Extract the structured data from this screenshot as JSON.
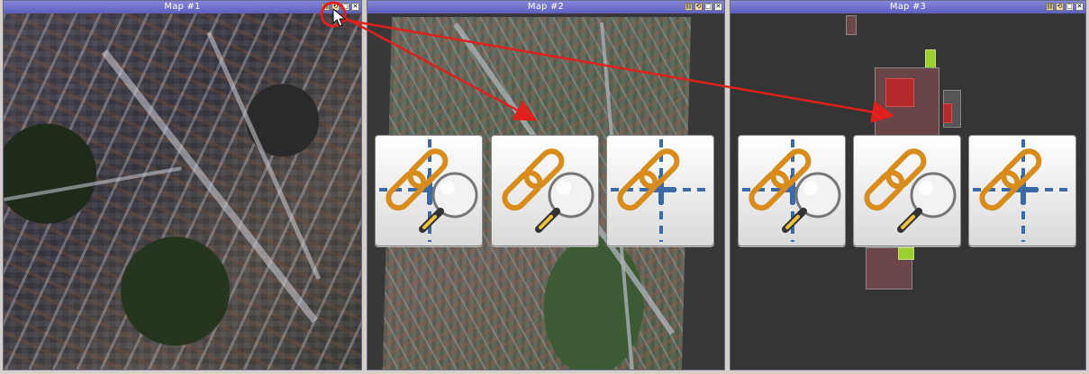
{
  "windows": [
    {
      "title": "Map #1"
    },
    {
      "title": "Map #2"
    },
    {
      "title": "Map #3"
    }
  ],
  "titlebar_buttons": [
    "link-icon",
    "sync-icon",
    "maximize-icon",
    "close-icon"
  ],
  "close_glyph": "✕",
  "tools": [
    {
      "name": "link-pan-zoom-tool",
      "icon": "link-pan-zoom-icon"
    },
    {
      "name": "link-zoom-tool",
      "icon": "link-zoom-icon"
    },
    {
      "name": "link-pan-tool",
      "icon": "link-pan-icon"
    },
    {
      "name": "link-pan-zoom-tool",
      "icon": "link-pan-zoom-icon"
    },
    {
      "name": "link-zoom-tool",
      "icon": "link-zoom-icon"
    },
    {
      "name": "link-pan-tool",
      "icon": "link-pan-icon"
    }
  ],
  "colors": {
    "titlebar": "#5d5fc0",
    "annotation": "#e0201c",
    "chain": "#d98c1a",
    "crosshair": "#3a6aa8"
  }
}
